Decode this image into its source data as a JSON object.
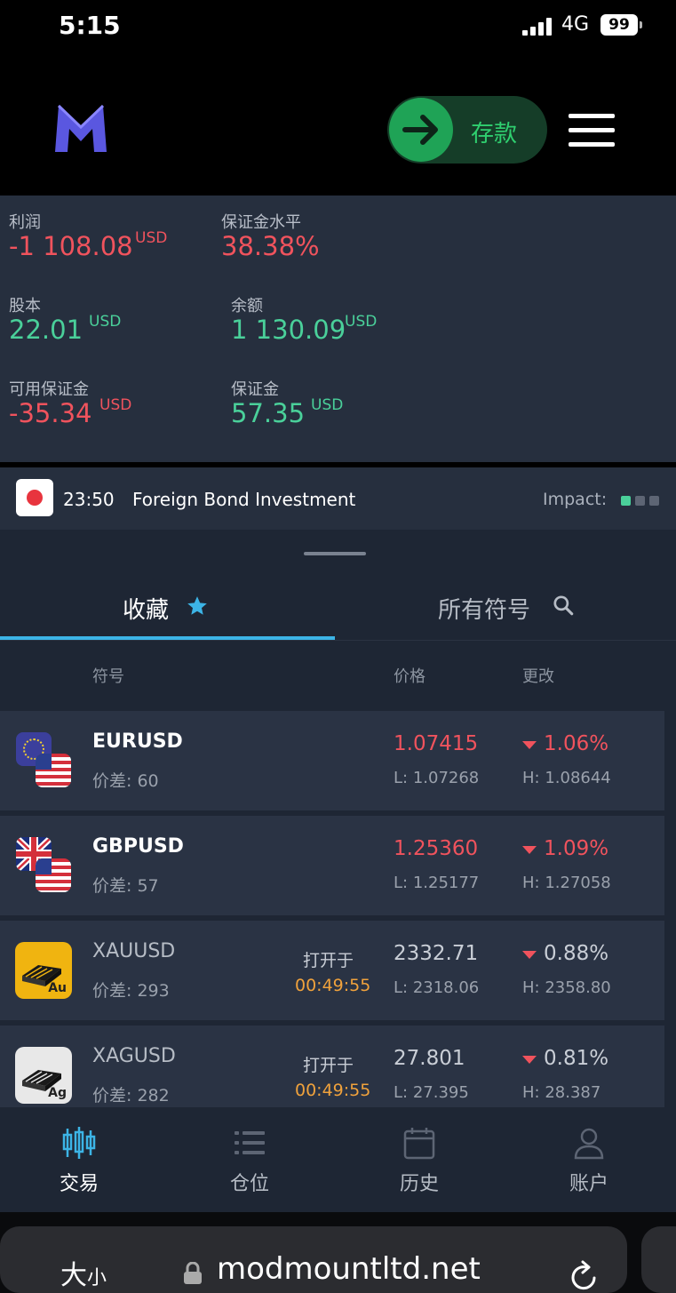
{
  "status_bar": {
    "time": "5:15",
    "network": "4G",
    "battery": "99"
  },
  "header": {
    "deposit_label": "存款"
  },
  "account": {
    "profit_label": "利润",
    "profit_value": "-1 108.08",
    "profit_unit": "USD",
    "margin_level_label": "保证金水平",
    "margin_level_value": "38.38%",
    "equity_label": "股本",
    "equity_value": "22.01",
    "equity_unit": "USD",
    "balance_label": "余额",
    "balance_value": "1 130.09",
    "balance_unit": "USD",
    "free_margin_label": "可用保证金",
    "free_margin_value": "-35.34",
    "free_margin_unit": "USD",
    "margin_label": "保证金",
    "margin_value": "57.35",
    "margin_unit": "USD"
  },
  "news": {
    "time": "23:50",
    "title": "Foreign Bond Investment",
    "impact_label": "Impact:",
    "impact_level": 1
  },
  "tabs": {
    "favorites": "收藏",
    "all_symbols": "所有符号"
  },
  "table_headers": {
    "symbol": "符号",
    "price": "价格",
    "change": "更改"
  },
  "instruments": [
    {
      "symbol": "EURUSD",
      "spread": "价差: 60",
      "price": "1.07415",
      "low": "L: 1.07268",
      "change": "1.06%",
      "high": "H: 1.08644"
    },
    {
      "symbol": "GBPUSD",
      "spread": "价差: 57",
      "price": "1.25360",
      "low": "L: 1.25177",
      "change": "1.09%",
      "high": "H: 1.27058"
    },
    {
      "symbol": "XAUUSD",
      "spread": "价差: 293",
      "open_label": "打开于",
      "open_time": "00:49:55",
      "price": "2332.71",
      "low": "L: 2318.06",
      "change": "0.88%",
      "high": "H: 2358.80",
      "badge": "Au"
    },
    {
      "symbol": "XAGUSD",
      "spread": "价差: 282",
      "open_label": "打开于",
      "open_time": "00:49:55",
      "price": "27.801",
      "low": "L: 27.395",
      "change": "0.81%",
      "high": "H: 28.387",
      "badge": "Ag"
    }
  ],
  "bottom_nav": [
    {
      "label": "交易",
      "icon": "candlestick-icon",
      "active": true
    },
    {
      "label": "仓位",
      "icon": "list-icon",
      "active": false
    },
    {
      "label": "历史",
      "icon": "calendar-icon",
      "active": false
    },
    {
      "label": "账户",
      "icon": "user-icon",
      "active": false
    }
  ],
  "browser": {
    "text_size_big": "大",
    "text_size_small": "小",
    "url": "modmountltd.net"
  },
  "colors": {
    "negative": "#f0535d",
    "positive": "#4ad09a",
    "accent": "#3cb4e6",
    "timer": "#f0a23c",
    "deposit": "#1fa356"
  }
}
